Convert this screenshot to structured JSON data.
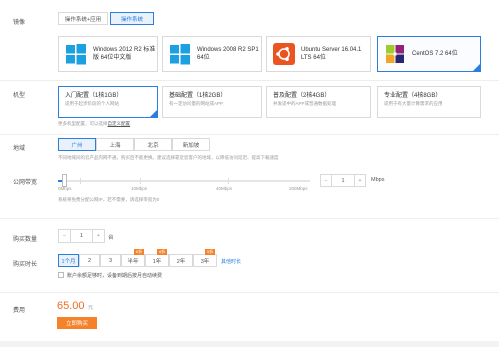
{
  "image": {
    "label": "镜像",
    "tabs": [
      "操作系统+应用",
      "操作系统"
    ],
    "os_options": [
      {
        "name": "Windows 2012 R2 标准版 64位中文版",
        "line1": "Windows 2012 R2 标准",
        "line2": "版 64位中文版",
        "icon": "windows-icon"
      },
      {
        "name": "Windows 2008 R2 SP1 64位",
        "line1": "Windows 2008 R2 SP1",
        "line2": "64位",
        "icon": "windows-icon"
      },
      {
        "name": "Ubuntu Server 16.04.1 LTS 64位",
        "line1": "Ubuntu Server 16.04.1",
        "line2": "LTS 64位",
        "icon": "ubuntu-icon"
      },
      {
        "name": "CentOS 7.2 64位",
        "line1": "CentOS 7.2 64位",
        "line2": "",
        "icon": "centos-icon"
      }
    ]
  },
  "model": {
    "label": "机型",
    "options": [
      {
        "title": "入门配置（1核1GB）",
        "desc": "适用于起步阶段的个人网站"
      },
      {
        "title": "基础配置（1核2GB）",
        "desc": "有一定访问量的网站或APP"
      },
      {
        "title": "普及配置（2核4GB）",
        "desc": "并发适中的APP或普通数据处理"
      },
      {
        "title": "专业配置（4核8GB）",
        "desc": "适用于有大量计算需求的应用"
      }
    ],
    "note_prefix": "更多机型配置，可以选择",
    "note_link": "自定义配置"
  },
  "region": {
    "label": "地域",
    "options": [
      "广州",
      "上海",
      "北京",
      "新加坡"
    ],
    "note": "不同地域间的云产品内网不通，购买后不能更换。建议选择靠近您客户的地域，以降低访问延迟、提高下载速度"
  },
  "bandwidth": {
    "label": "公网带宽",
    "ticks": [
      "0Mbps",
      "10Mbps",
      "40Mbps",
      "200Mbps"
    ],
    "value": "1",
    "unit": "Mbps",
    "minus": "−",
    "plus": "+",
    "note": "系统将免费分配公网IP，若不需要，请选择带宽为0"
  },
  "quantity": {
    "label": "购买数量",
    "value": "1",
    "unit": "台",
    "minus": "−",
    "plus": "+"
  },
  "duration": {
    "label": "购买时长",
    "options": [
      "1个月",
      "2",
      "3",
      "半年",
      "1年",
      "2年",
      "3年"
    ],
    "badges": [
      "",
      "",
      "",
      "8折",
      "8折",
      "",
      "5折"
    ],
    "other_link": "其他时长",
    "auto_renew": "账户余额足够时，设备到期后按月自动续费"
  },
  "fee": {
    "label": "费用",
    "amount": "65.00",
    "currency": "元",
    "buy_button": "立即购买"
  },
  "colors": {
    "accent": "#2a7de1",
    "price": "#f06b1e",
    "buy": "#f5822a",
    "badge": "#f5822a"
  }
}
